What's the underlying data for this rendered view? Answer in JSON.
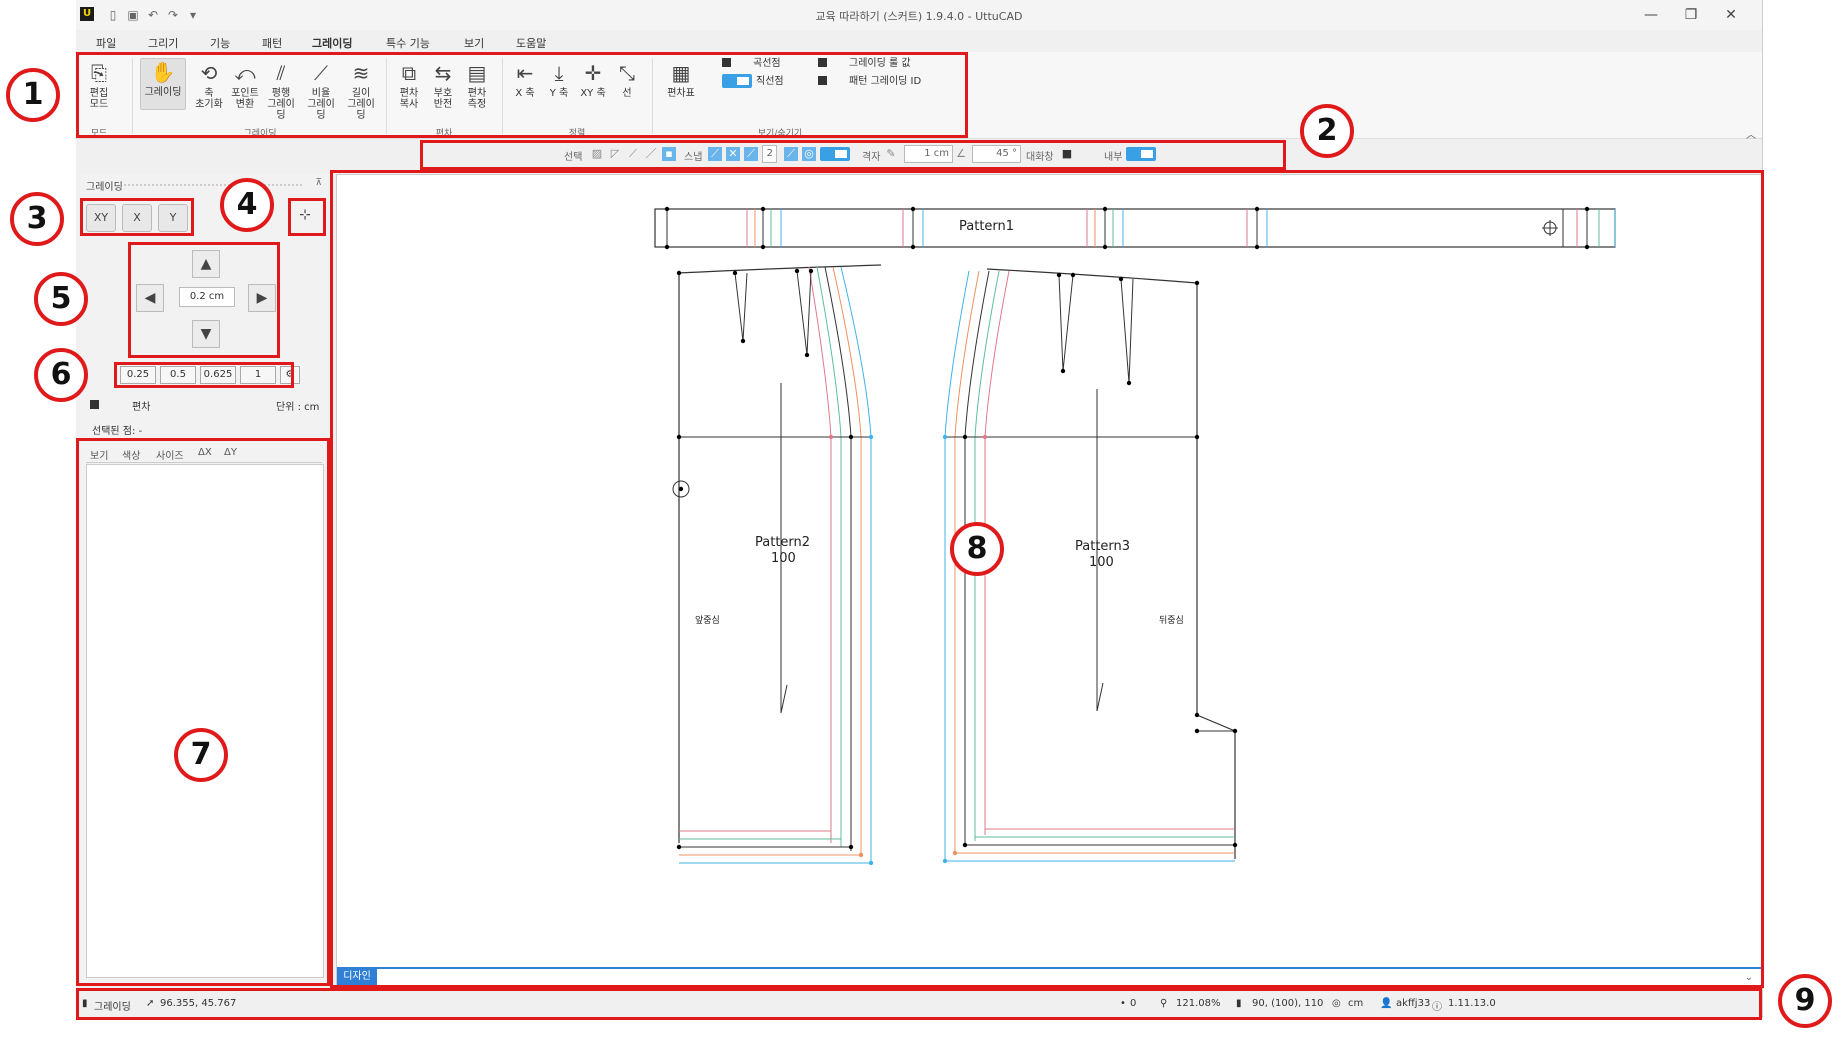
{
  "window": {
    "title": "교육 따라하기 (스커트) 1.9.4.0 - UttuCAD",
    "app_icon": "U"
  },
  "menu": [
    "파일",
    "그리기",
    "기능",
    "패턴",
    "그레이딩",
    "특수 기능",
    "보기",
    "도움말"
  ],
  "ribbon": {
    "mode": {
      "edit_mode": "편집\n모드",
      "group": "모드"
    },
    "grading": {
      "buttons": [
        "그레이딩",
        "축\n초기화",
        "포인트\n변환",
        "평행\n그레이딩",
        "비율\n그레이딩",
        "길이\n그레이딩"
      ],
      "group": "그레이딩"
    },
    "deviation": {
      "buttons": [
        "편차\n복사",
        "부호\n반전",
        "편차\n측정"
      ],
      "group": "편차"
    },
    "align": {
      "buttons": [
        "X 축",
        "Y 축",
        "XY 축",
        "선"
      ],
      "group": "정렬"
    },
    "view": {
      "size_chart": "편차표",
      "curve_point": "곡선점",
      "straight_point": "직선점",
      "grading_rule_value": "그레이딩 룰 값",
      "pattern_grading_id": "패턴 그레이딩 ID",
      "group": "보기/숨기기"
    }
  },
  "toolbar2": {
    "select_label": "선택",
    "snap_label": "스냅",
    "snap_count": "2",
    "grid_label": "격자",
    "grid_value": "1 cm",
    "angle_value": "45 °",
    "dialog_label": "대화창",
    "inner_label": "내부"
  },
  "panel": {
    "title": "그레이딩",
    "axis_buttons": [
      "XY",
      "X",
      "Y"
    ],
    "step_value": "0.2 cm",
    "presets": [
      "0.25",
      "0.5",
      "0.625",
      "1"
    ],
    "deviation_label": "편차",
    "unit_label": "단위 : cm",
    "selected_point": "선택된 점: -",
    "table_columns": [
      "보기",
      "색상",
      "사이즈",
      "ΔX",
      "ΔY"
    ]
  },
  "canvas": {
    "patterns": [
      {
        "name": "Pattern1"
      },
      {
        "name": "Pattern2",
        "size": "100",
        "note": "앞중심"
      },
      {
        "name": "Pattern3",
        "size": "100",
        "note": "뒤중심"
      }
    ],
    "tab": "디자인"
  },
  "status": {
    "mode": "그레이딩",
    "cursor": "96.355, 45.767",
    "count": "0",
    "zoom": "121.08%",
    "sizes": "90, (100), 110",
    "unit": "cm",
    "user": "akffj33",
    "version": "1.11.13.0"
  },
  "annotations": [
    "1",
    "2",
    "3",
    "4",
    "5",
    "6",
    "7",
    "8",
    "9"
  ],
  "colors": {
    "annotation": "#e01a1a",
    "accent": "#39a0e6",
    "grade_red": "#e07a8a",
    "grade_orange": "#f09060",
    "grade_green": "#5fbf9a",
    "grade_blue": "#3fb3e8"
  }
}
